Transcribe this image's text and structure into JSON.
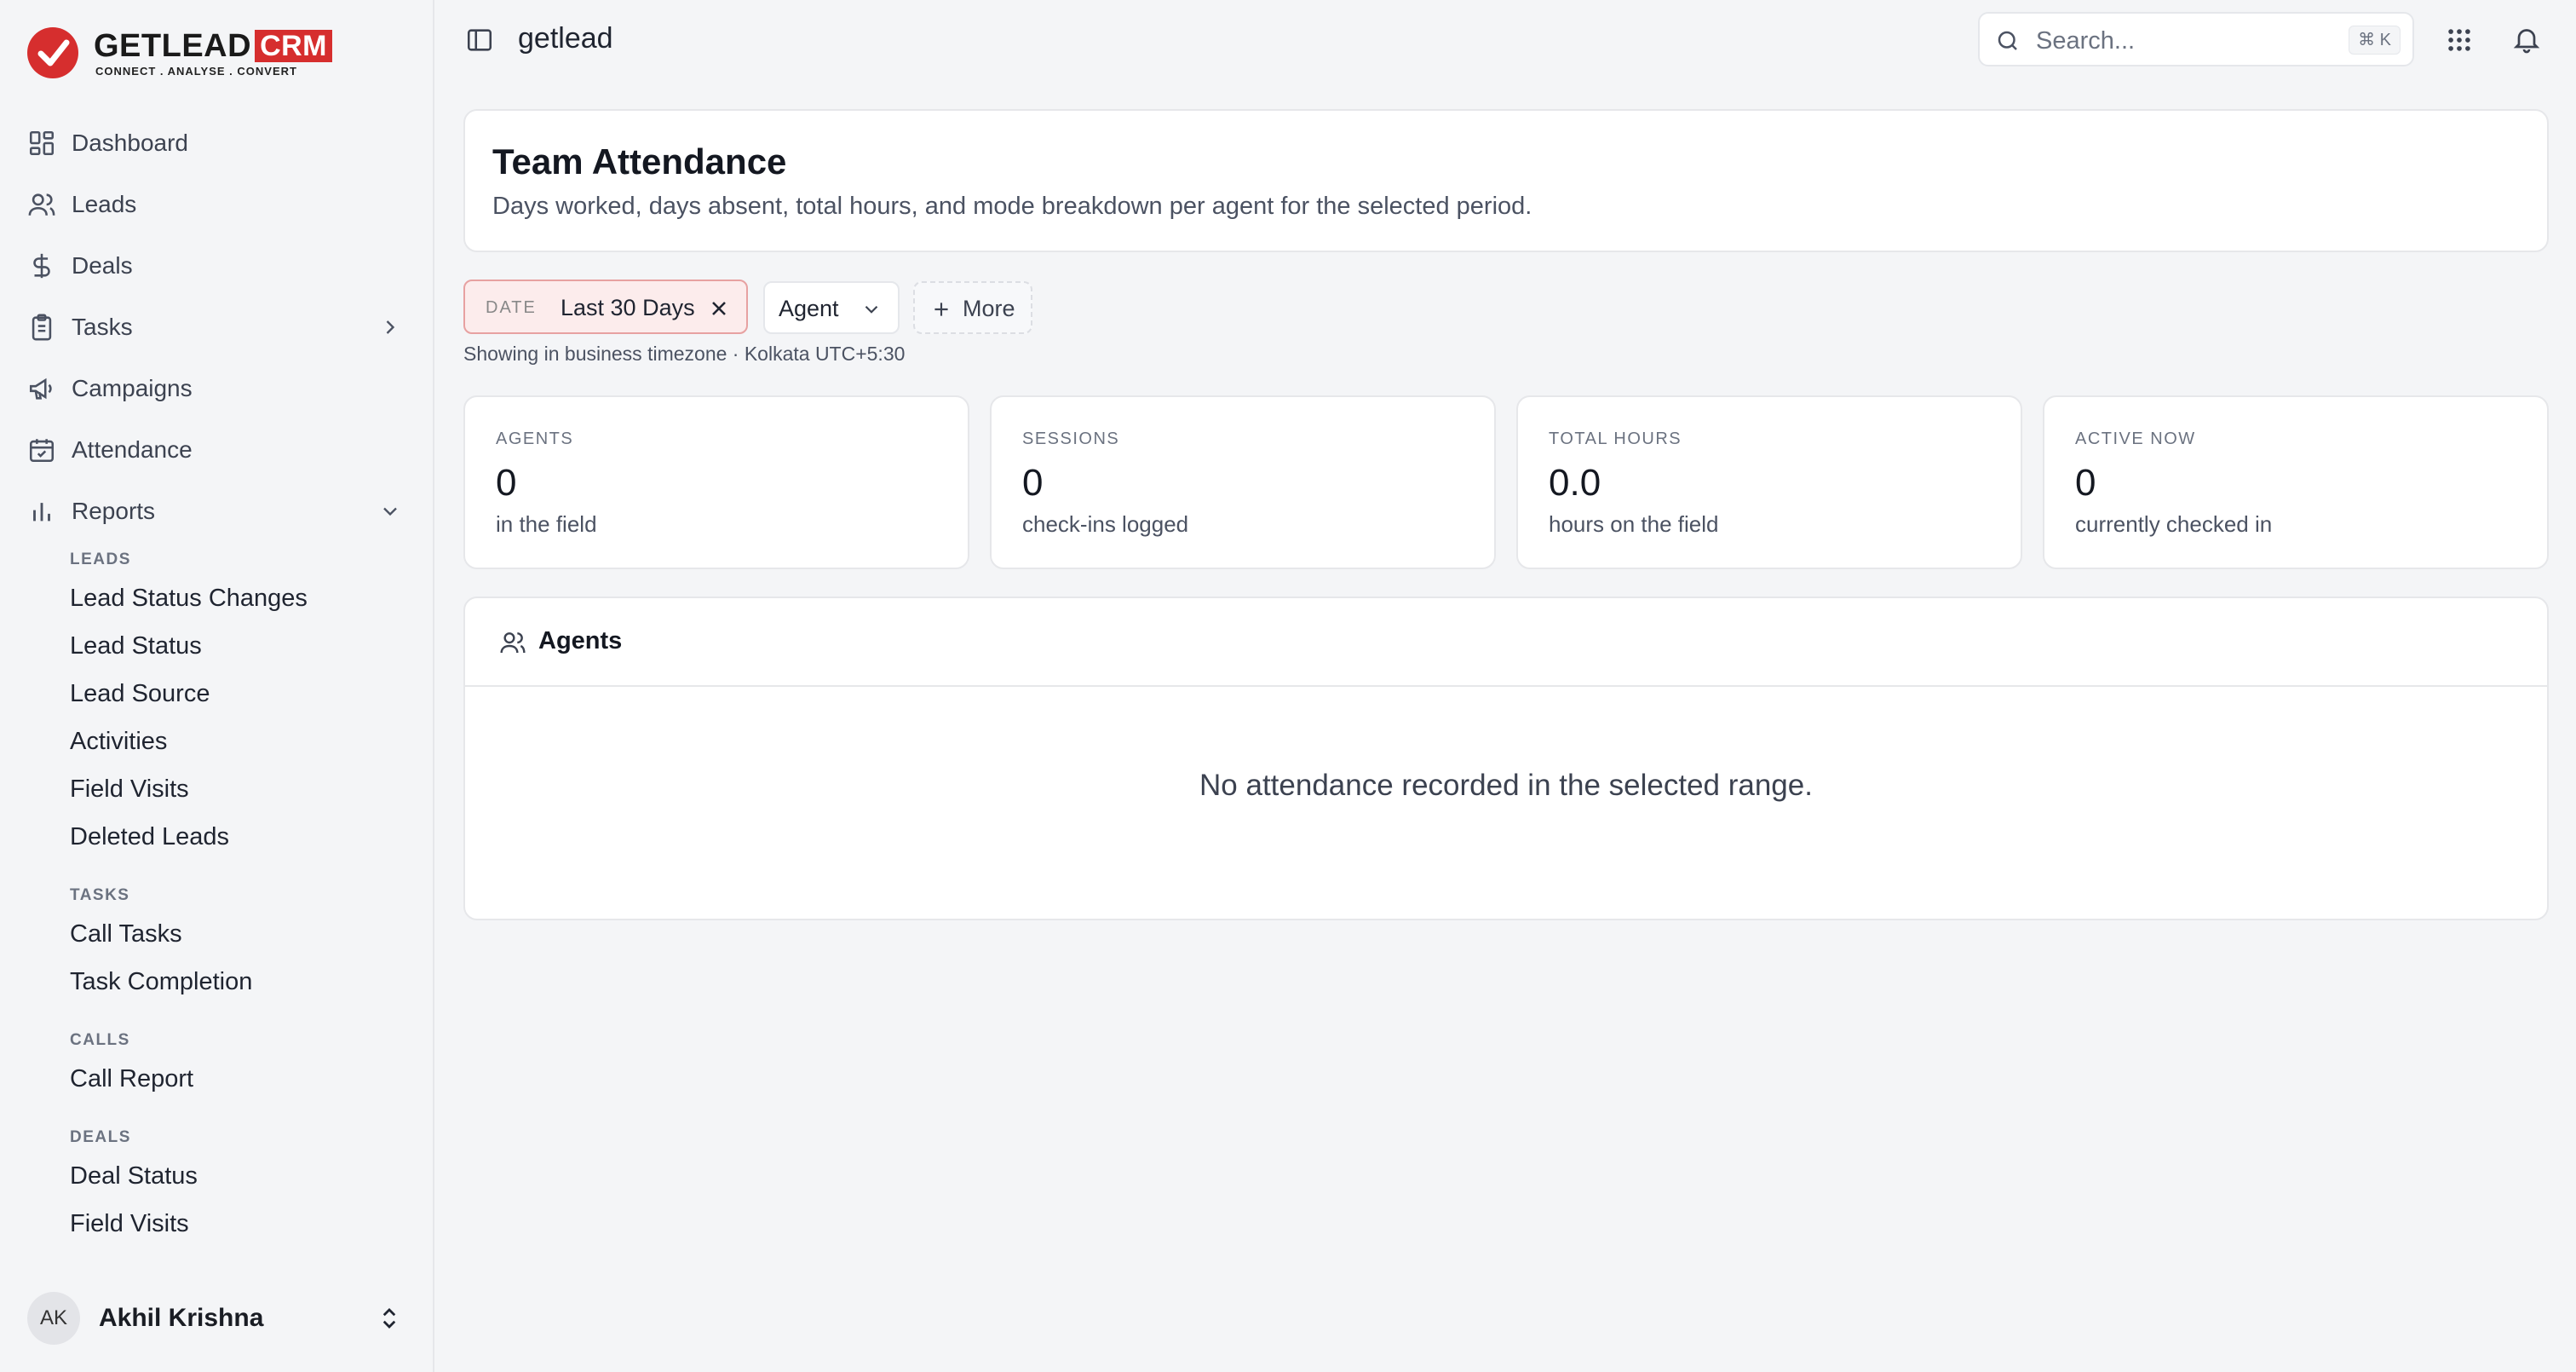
{
  "brand": {
    "name": "GETLEAD",
    "suffix": "CRM",
    "tagline": "CONNECT  .  ANALYSE  .  CONVERT",
    "accent": "#d62e2e"
  },
  "nav": {
    "items": [
      {
        "label": "Dashboard",
        "icon": "dashboard-grid-icon"
      },
      {
        "label": "Leads",
        "icon": "users-icon"
      },
      {
        "label": "Deals",
        "icon": "dollar-icon"
      },
      {
        "label": "Tasks",
        "icon": "clipboard-icon"
      },
      {
        "label": "Campaigns",
        "icon": "megaphone-icon"
      },
      {
        "label": "Attendance",
        "icon": "calendar-check-icon"
      },
      {
        "label": "Reports",
        "icon": "bar-chart-icon"
      }
    ]
  },
  "reports": {
    "leads": {
      "heading": "LEADS",
      "items": [
        "Lead Status Changes",
        "Lead Status",
        "Lead Source",
        "Activities",
        "Field Visits",
        "Deleted Leads"
      ]
    },
    "tasks": {
      "heading": "TASKS",
      "items": [
        "Call Tasks",
        "Task Completion"
      ]
    },
    "calls": {
      "heading": "CALLS",
      "items": [
        "Call Report"
      ]
    },
    "deals": {
      "heading": "DEALS",
      "items": [
        "Deal Status",
        "Field Visits"
      ]
    }
  },
  "user": {
    "initials": "AK",
    "name": "Akhil Krishna"
  },
  "topbar": {
    "workspace": "getlead",
    "search_placeholder": "Search...",
    "search_shortcut": "⌘ K"
  },
  "page": {
    "title": "Team Attendance",
    "subtitle": "Days worked, days absent, total hours, and mode breakdown per agent for the selected period."
  },
  "filters": {
    "date_label": "DATE",
    "date_value": "Last 30 Days",
    "agent_label": "Agent",
    "more_label": "More",
    "timezone_note": "Showing in business timezone · Kolkata UTC+5:30"
  },
  "stats": [
    {
      "label": "AGENTS",
      "value": "0",
      "sub": "in the field"
    },
    {
      "label": "SESSIONS",
      "value": "0",
      "sub": "check-ins logged"
    },
    {
      "label": "TOTAL HOURS",
      "value": "0.0",
      "sub": "hours on the field"
    },
    {
      "label": "ACTIVE NOW",
      "value": "0",
      "sub": "currently checked in"
    }
  ],
  "agents_panel": {
    "title": "Agents",
    "empty_message": "No attendance recorded in the selected range."
  }
}
